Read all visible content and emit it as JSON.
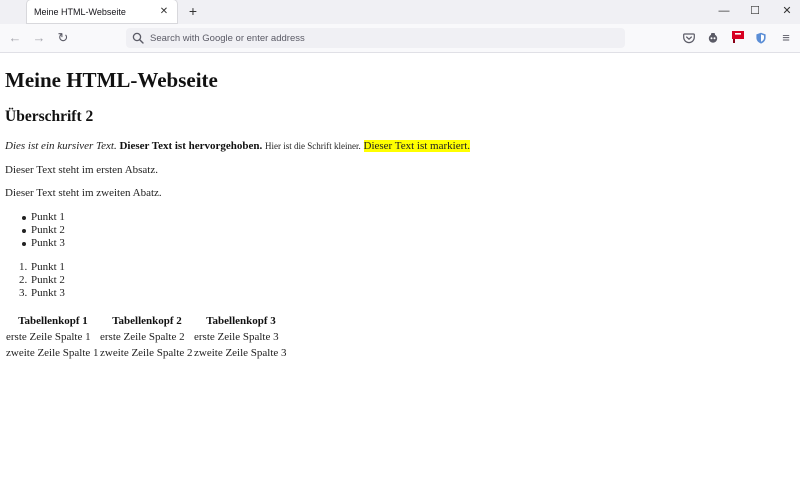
{
  "browser": {
    "tab": {
      "title": "Meine HTML-Webseite",
      "close_symbol": "✕"
    },
    "new_tab_symbol": "+",
    "window_controls": {
      "minimize": "—",
      "maximize": "☐",
      "close": "✕"
    },
    "nav": {
      "back_symbol": "←",
      "forward_symbol": "→",
      "reload_symbol": "↻",
      "menu_symbol": "≡",
      "address_placeholder": "Search with Google or enter address",
      "address_value": ""
    },
    "toolbar_icons": [
      "pocket-icon",
      "extension-icon",
      "flag-extension-icon",
      "shield-icon",
      "menu-icon"
    ],
    "colors": {
      "tabstrip": "#f0f0f4",
      "urlbar": "#f0f0f4",
      "flag_icon": "#d70022",
      "shield_icon": "#5b8ed6"
    }
  },
  "page": {
    "h1": "Meine HTML-Webseite",
    "h2": "Überschrift 2",
    "mixed": {
      "italic": "Dies ist ein kursiver Text.",
      "bold": "Dieser Text ist hervorgehoben.",
      "small": "Hier ist die Schrift kleiner.",
      "marked": "Dieser Text ist markiert."
    },
    "paragraph1": "Dieser Text steht im ersten Absatz.",
    "paragraph2": "Dieser Text steht im zweiten Abatz.",
    "unordered_list": [
      "Punkt 1",
      "Punkt 2",
      "Punkt 3"
    ],
    "ordered_list": [
      "Punkt 1",
      "Punkt 2",
      "Punkt 3"
    ],
    "ordered_numbers": [
      "1.",
      "2.",
      "3."
    ],
    "table": {
      "headers": [
        "Tabellenkopf 1",
        "Tabellenkopf 2",
        "Tabellenkopf 3"
      ],
      "rows": [
        [
          "erste Zeile Spalte 1",
          "erste Zeile Spalte 2",
          "erste Zeile Spalte 3"
        ],
        [
          "zweite Zeile Spalte 1",
          "zweite Zeile Spalte 2",
          "zweite Zeile Spalte 3"
        ]
      ]
    },
    "colors": {
      "mark_highlight": "#ffff00"
    }
  }
}
